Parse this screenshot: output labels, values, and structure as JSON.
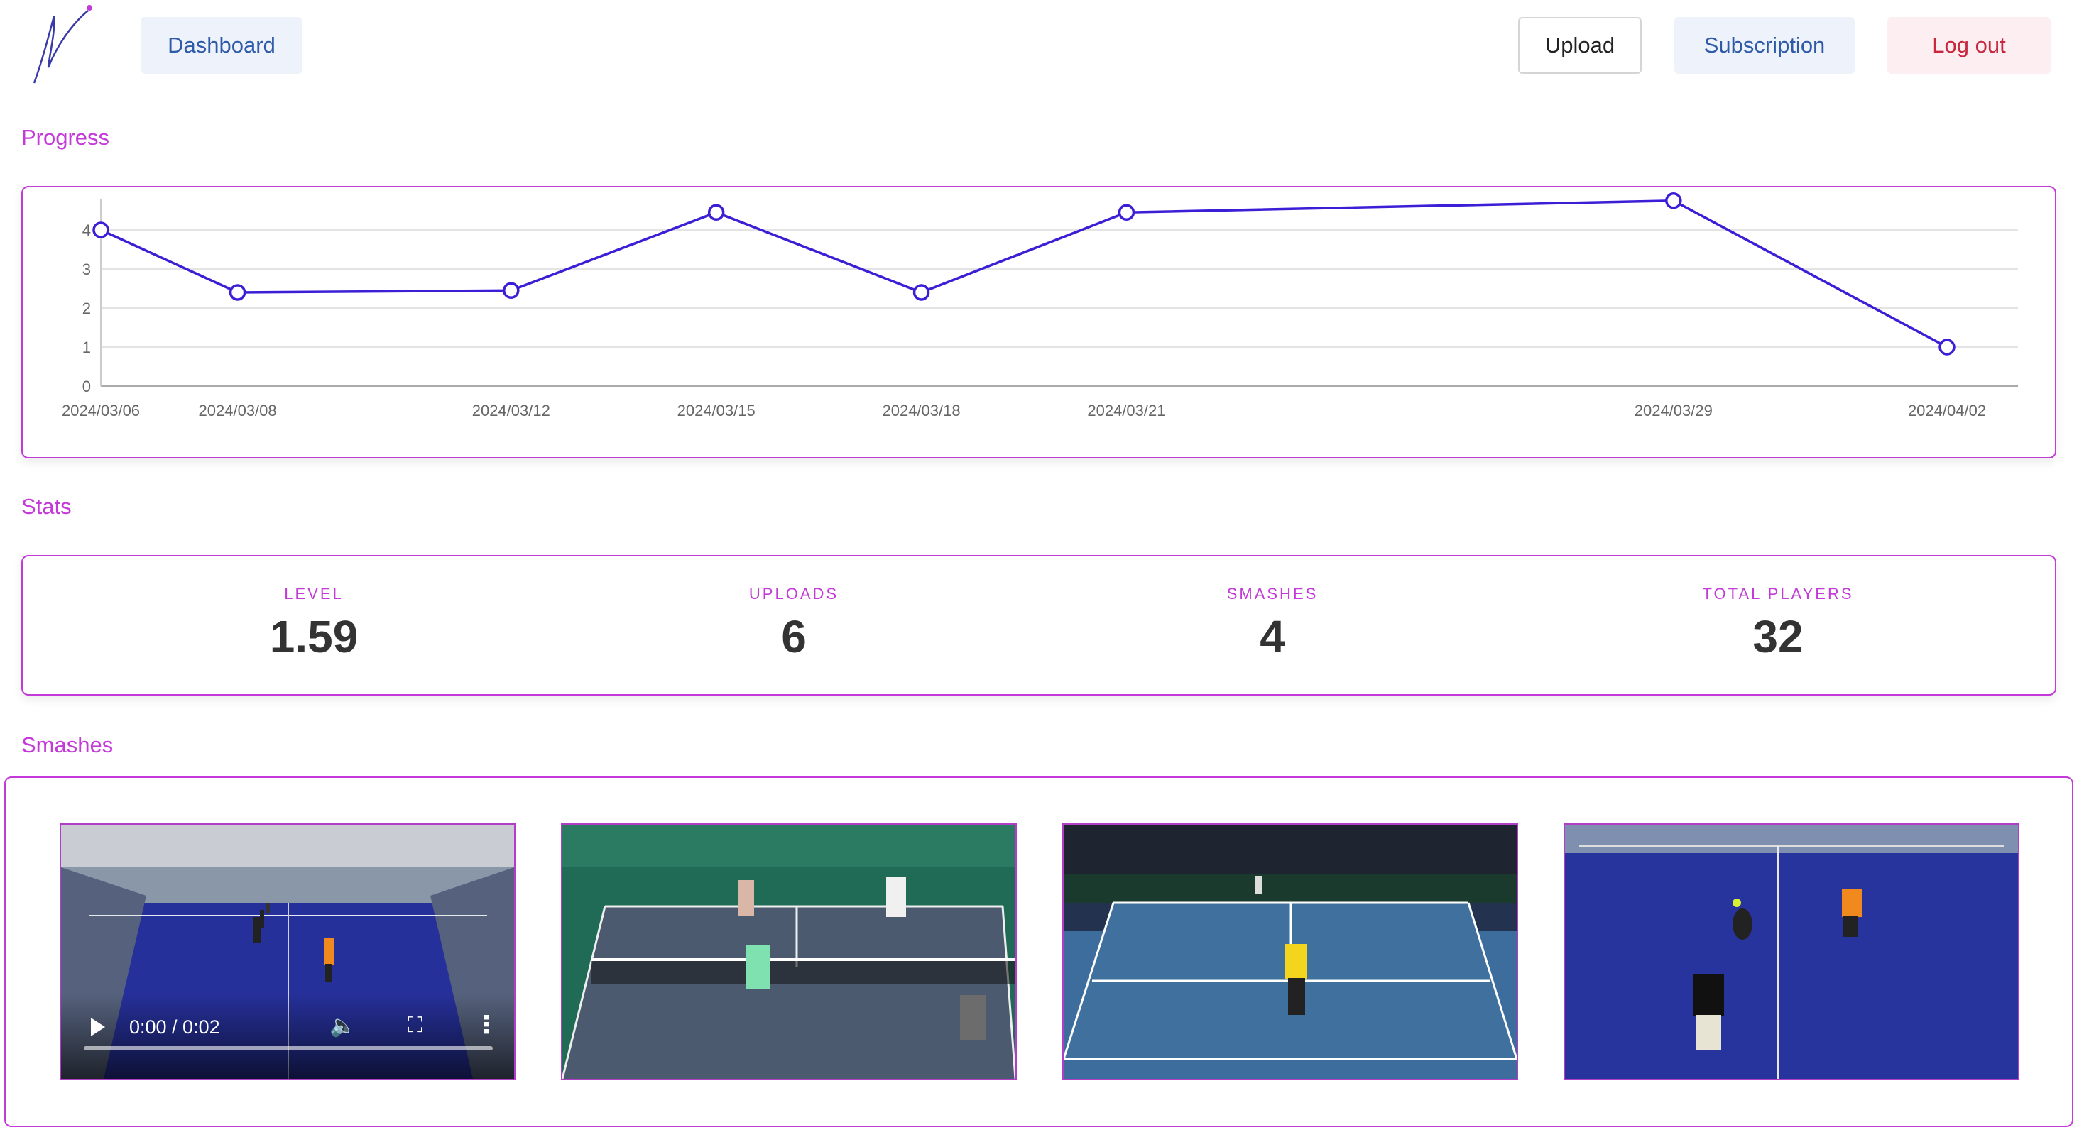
{
  "header": {
    "dashboard_label": "Dashboard",
    "upload_label": "Upload",
    "subscription_label": "Subscription",
    "logout_label": "Log out"
  },
  "sections": {
    "progress": "Progress",
    "stats": "Stats",
    "smashes": "Smashes"
  },
  "chart_data": {
    "type": "line",
    "x": [
      "2024/03/06",
      "2024/03/08",
      "2024/03/12",
      "2024/03/15",
      "2024/03/18",
      "2024/03/21",
      "2024/03/29",
      "2024/04/02"
    ],
    "series": [
      {
        "values": [
          4.0,
          2.4,
          2.45,
          4.45,
          2.4,
          4.45,
          4.75,
          1.0
        ]
      }
    ],
    "yticks": [
      0,
      1,
      2,
      3,
      4
    ],
    "ylim": [
      0,
      4.8
    ],
    "grid": true,
    "line_color": "#3a1fd6"
  },
  "stats": [
    {
      "label": "LEVEL",
      "value": "1.59"
    },
    {
      "label": "UPLOADS",
      "value": "6"
    },
    {
      "label": "SMASHES",
      "value": "4"
    },
    {
      "label": "TOTAL PLAYERS",
      "value": "32"
    }
  ],
  "videos": [
    {
      "time": "0:00 / 0:02",
      "scene": "padel-indoor"
    },
    {
      "scene": "pickleball"
    },
    {
      "scene": "tennis"
    },
    {
      "scene": "padel-closeup"
    }
  ],
  "colors": {
    "accent": "#c43ad9",
    "line": "#3a1fd6",
    "logout": "#c8283f"
  }
}
